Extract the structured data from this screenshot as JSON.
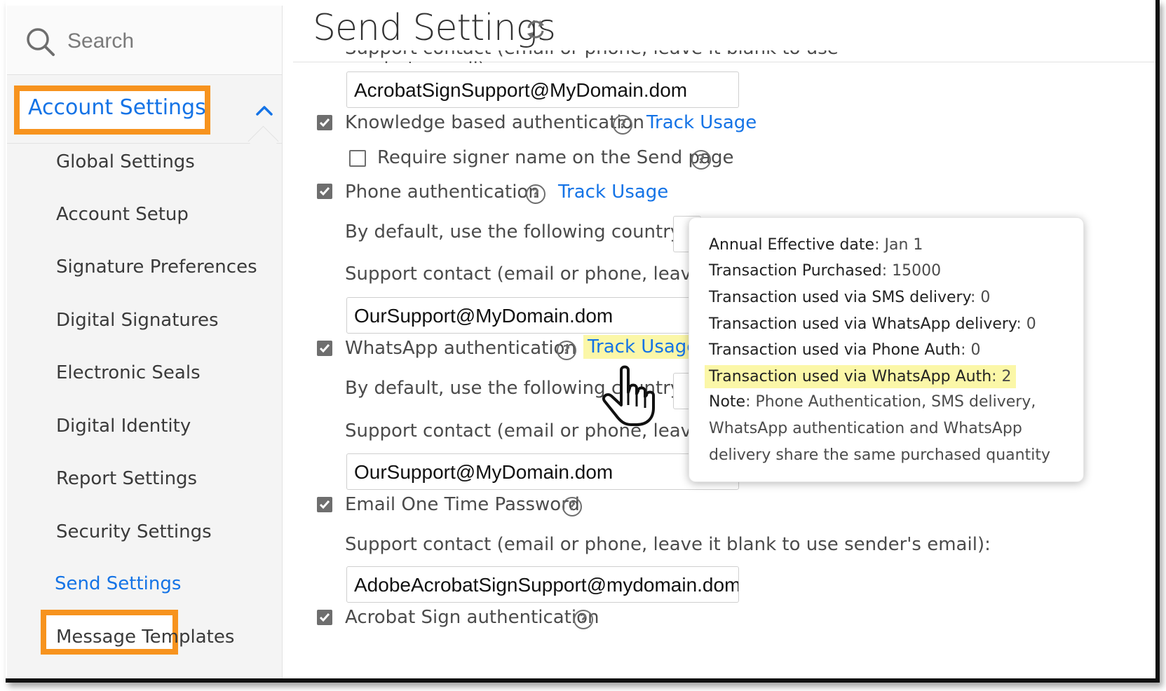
{
  "sidebar": {
    "search": {
      "placeholder": "Search",
      "icon": "search-icon"
    },
    "section_title": "Account Settings",
    "items": [
      {
        "label": "Global Settings"
      },
      {
        "label": "Account Setup"
      },
      {
        "label": "Signature Preferences"
      },
      {
        "label": "Digital Signatures"
      },
      {
        "label": "Electronic Seals"
      },
      {
        "label": "Digital Identity"
      },
      {
        "label": "Report Settings"
      },
      {
        "label": "Security Settings"
      },
      {
        "label": "Send Settings",
        "active": true
      },
      {
        "label": "Message Templates"
      }
    ]
  },
  "main": {
    "title": "Send Settings",
    "cut_top_text": "Support contact (email or phone, leave it blank to use sender's email):",
    "kba_support_value": "AcrobatSignSupport@MyDomain.dom",
    "kba": {
      "label": "Knowledge based authentication",
      "checked": true,
      "link": "Track Usage"
    },
    "require_signer": {
      "label": "Require signer name on the Send page",
      "checked": false
    },
    "phone_auth": {
      "label": "Phone authentication",
      "checked": true,
      "link": "Track Usage",
      "country_label": "By default, use the following country code:",
      "support_label": "Support contact (email or phone, leave it blank to use sender's email):",
      "support_value": "OurSupport@MyDomain.dom"
    },
    "whatsapp_auth": {
      "label": "WhatsApp authentication",
      "checked": true,
      "link": "Track Usage",
      "country_label": "By default, use the following country code:",
      "support_label": "Support contact (email or phone, leave it blank to use sender's email):",
      "support_value": "OurSupport@MyDomain.dom"
    },
    "email_otp": {
      "label": "Email One Time Password",
      "checked": true,
      "support_label": "Support contact (email or phone, leave it blank to use sender's email):",
      "support_value": "AdobeAcrobatSignSupport@mydomain.dom"
    },
    "acrobat_sign_auth": {
      "label": "Acrobat Sign authentication",
      "checked": true
    }
  },
  "popover": {
    "rows": [
      {
        "key": "Annual Effective date",
        "value": ": Jan 1"
      },
      {
        "key": "Transaction Purchased",
        "value": ": 15000"
      },
      {
        "key": "Transaction used via SMS delivery",
        "value": ": 0"
      },
      {
        "key": "Transaction used via WhatsApp delivery",
        "value": ": 0"
      },
      {
        "key": "Transaction used via Phone Auth",
        "value": ": 0"
      },
      {
        "key": "Transaction used via WhatsApp Auth",
        "value": ": 2",
        "highlighted": true
      }
    ],
    "note_key": "Note",
    "note_lines": [
      ": Phone Authentication, SMS delivery,",
      "WhatsApp authentication and WhatsApp",
      "delivery share the same purchased quantity"
    ]
  },
  "colors": {
    "accent": "#1473e6",
    "highlight_box": "#f7931e",
    "highlight_text": "#fbf7a8"
  }
}
